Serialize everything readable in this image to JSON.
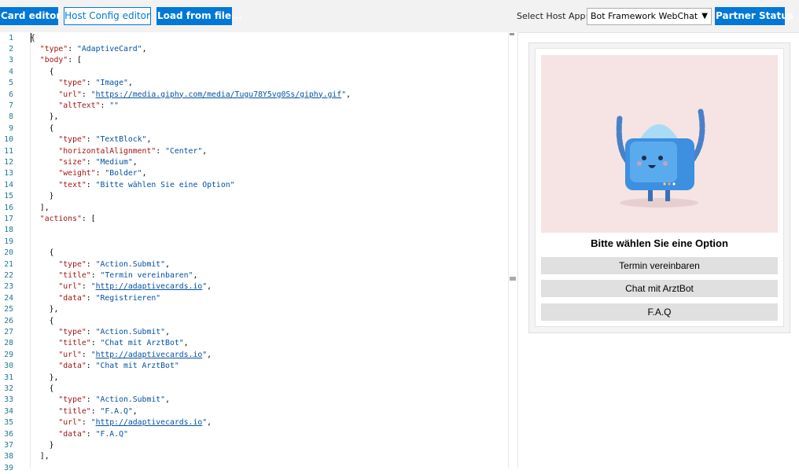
{
  "toolbar": {
    "card_editor": "Card editor",
    "host_config_editor": "Host Config editor",
    "load_from_file": "Load from file...",
    "host_label": "Select Host App:",
    "host_value": "Bot Framework WebChat",
    "partner_status": "Partner Status"
  },
  "editor": {
    "lines": [
      [
        {
          "t": "p",
          "v": "{"
        }
      ],
      [
        {
          "t": "p",
          "v": "  "
        },
        {
          "t": "k",
          "v": "\"type\""
        },
        {
          "t": "p",
          "v": ": "
        },
        {
          "t": "s",
          "v": "\"AdaptiveCard\""
        },
        {
          "t": "p",
          "v": ","
        }
      ],
      [
        {
          "t": "p",
          "v": "  "
        },
        {
          "t": "k",
          "v": "\"body\""
        },
        {
          "t": "p",
          "v": ": ["
        }
      ],
      [
        {
          "t": "p",
          "v": "    {"
        }
      ],
      [
        {
          "t": "p",
          "v": "      "
        },
        {
          "t": "k",
          "v": "\"type\""
        },
        {
          "t": "p",
          "v": ": "
        },
        {
          "t": "s",
          "v": "\"Image\""
        },
        {
          "t": "p",
          "v": ","
        }
      ],
      [
        {
          "t": "p",
          "v": "      "
        },
        {
          "t": "k",
          "v": "\"url\""
        },
        {
          "t": "p",
          "v": ": "
        },
        {
          "t": "s",
          "v": "\""
        },
        {
          "t": "u",
          "v": "https://media.giphy.com/media/Tugu78Y5vg0Ss/giphy.gif"
        },
        {
          "t": "s",
          "v": "\""
        },
        {
          "t": "p",
          "v": ","
        }
      ],
      [
        {
          "t": "p",
          "v": "      "
        },
        {
          "t": "k",
          "v": "\"altText\""
        },
        {
          "t": "p",
          "v": ": "
        },
        {
          "t": "s",
          "v": "\"\""
        }
      ],
      [
        {
          "t": "p",
          "v": "    },"
        }
      ],
      [
        {
          "t": "p",
          "v": "    {"
        }
      ],
      [
        {
          "t": "p",
          "v": "      "
        },
        {
          "t": "k",
          "v": "\"type\""
        },
        {
          "t": "p",
          "v": ": "
        },
        {
          "t": "s",
          "v": "\"TextBlock\""
        },
        {
          "t": "p",
          "v": ","
        }
      ],
      [
        {
          "t": "p",
          "v": "      "
        },
        {
          "t": "k",
          "v": "\"horizontalAlignment\""
        },
        {
          "t": "p",
          "v": ": "
        },
        {
          "t": "s",
          "v": "\"Center\""
        },
        {
          "t": "p",
          "v": ","
        }
      ],
      [
        {
          "t": "p",
          "v": "      "
        },
        {
          "t": "k",
          "v": "\"size\""
        },
        {
          "t": "p",
          "v": ": "
        },
        {
          "t": "s",
          "v": "\"Medium\""
        },
        {
          "t": "p",
          "v": ","
        }
      ],
      [
        {
          "t": "p",
          "v": "      "
        },
        {
          "t": "k",
          "v": "\"weight\""
        },
        {
          "t": "p",
          "v": ": "
        },
        {
          "t": "s",
          "v": "\"Bolder\""
        },
        {
          "t": "p",
          "v": ","
        }
      ],
      [
        {
          "t": "p",
          "v": "      "
        },
        {
          "t": "k",
          "v": "\"text\""
        },
        {
          "t": "p",
          "v": ": "
        },
        {
          "t": "s",
          "v": "\"Bitte wählen Sie eine Option\""
        }
      ],
      [
        {
          "t": "p",
          "v": "    }"
        }
      ],
      [
        {
          "t": "p",
          "v": "  ],"
        }
      ],
      [
        {
          "t": "p",
          "v": "  "
        },
        {
          "t": "k",
          "v": "\"actions\""
        },
        {
          "t": "p",
          "v": ": ["
        }
      ],
      [],
      [],
      [
        {
          "t": "p",
          "v": "    {"
        }
      ],
      [
        {
          "t": "p",
          "v": "      "
        },
        {
          "t": "k",
          "v": "\"type\""
        },
        {
          "t": "p",
          "v": ": "
        },
        {
          "t": "s",
          "v": "\"Action.Submit\""
        },
        {
          "t": "p",
          "v": ","
        }
      ],
      [
        {
          "t": "p",
          "v": "      "
        },
        {
          "t": "k",
          "v": "\"title\""
        },
        {
          "t": "p",
          "v": ": "
        },
        {
          "t": "s",
          "v": "\"Termin vereinbaren\""
        },
        {
          "t": "p",
          "v": ","
        }
      ],
      [
        {
          "t": "p",
          "v": "      "
        },
        {
          "t": "k",
          "v": "\"url\""
        },
        {
          "t": "p",
          "v": ": "
        },
        {
          "t": "s",
          "v": "\""
        },
        {
          "t": "u",
          "v": "http://adaptivecards.io"
        },
        {
          "t": "s",
          "v": "\""
        },
        {
          "t": "p",
          "v": ","
        }
      ],
      [
        {
          "t": "p",
          "v": "      "
        },
        {
          "t": "k",
          "v": "\"data\""
        },
        {
          "t": "p",
          "v": ": "
        },
        {
          "t": "s",
          "v": "\"Registrieren\""
        }
      ],
      [
        {
          "t": "p",
          "v": "    },"
        }
      ],
      [
        {
          "t": "p",
          "v": "    {"
        }
      ],
      [
        {
          "t": "p",
          "v": "      "
        },
        {
          "t": "k",
          "v": "\"type\""
        },
        {
          "t": "p",
          "v": ": "
        },
        {
          "t": "s",
          "v": "\"Action.Submit\""
        },
        {
          "t": "p",
          "v": ","
        }
      ],
      [
        {
          "t": "p",
          "v": "      "
        },
        {
          "t": "k",
          "v": "\"title\""
        },
        {
          "t": "p",
          "v": ": "
        },
        {
          "t": "s",
          "v": "\"Chat mit ArztBot\""
        },
        {
          "t": "p",
          "v": ","
        }
      ],
      [
        {
          "t": "p",
          "v": "      "
        },
        {
          "t": "k",
          "v": "\"url\""
        },
        {
          "t": "p",
          "v": ": "
        },
        {
          "t": "s",
          "v": "\""
        },
        {
          "t": "u",
          "v": "http://adaptivecards.io"
        },
        {
          "t": "s",
          "v": "\""
        },
        {
          "t": "p",
          "v": ","
        }
      ],
      [
        {
          "t": "p",
          "v": "      "
        },
        {
          "t": "k",
          "v": "\"data\""
        },
        {
          "t": "p",
          "v": ": "
        },
        {
          "t": "s",
          "v": "\"Chat mit ArztBot\""
        }
      ],
      [
        {
          "t": "p",
          "v": "    },"
        }
      ],
      [
        {
          "t": "p",
          "v": "    {"
        }
      ],
      [
        {
          "t": "p",
          "v": "      "
        },
        {
          "t": "k",
          "v": "\"type\""
        },
        {
          "t": "p",
          "v": ": "
        },
        {
          "t": "s",
          "v": "\"Action.Submit\""
        },
        {
          "t": "p",
          "v": ","
        }
      ],
      [
        {
          "t": "p",
          "v": "      "
        },
        {
          "t": "k",
          "v": "\"title\""
        },
        {
          "t": "p",
          "v": ": "
        },
        {
          "t": "s",
          "v": "\"F.A.Q\""
        },
        {
          "t": "p",
          "v": ","
        }
      ],
      [
        {
          "t": "p",
          "v": "      "
        },
        {
          "t": "k",
          "v": "\"url\""
        },
        {
          "t": "p",
          "v": ": "
        },
        {
          "t": "s",
          "v": "\""
        },
        {
          "t": "u",
          "v": "http://adaptivecards.io"
        },
        {
          "t": "s",
          "v": "\""
        },
        {
          "t": "p",
          "v": ","
        }
      ],
      [
        {
          "t": "p",
          "v": "      "
        },
        {
          "t": "k",
          "v": "\"data\""
        },
        {
          "t": "p",
          "v": ": "
        },
        {
          "t": "s",
          "v": "\"F.A.Q\""
        }
      ],
      [
        {
          "t": "p",
          "v": "    }"
        }
      ],
      [
        {
          "t": "p",
          "v": "  ],"
        }
      ]
    ],
    "partial_line_number": "39"
  },
  "preview": {
    "title": "Bitte wählen Sie eine Option",
    "actions": [
      "Termin vereinbaren",
      "Chat mit ArztBot",
      "F.A.Q"
    ]
  }
}
